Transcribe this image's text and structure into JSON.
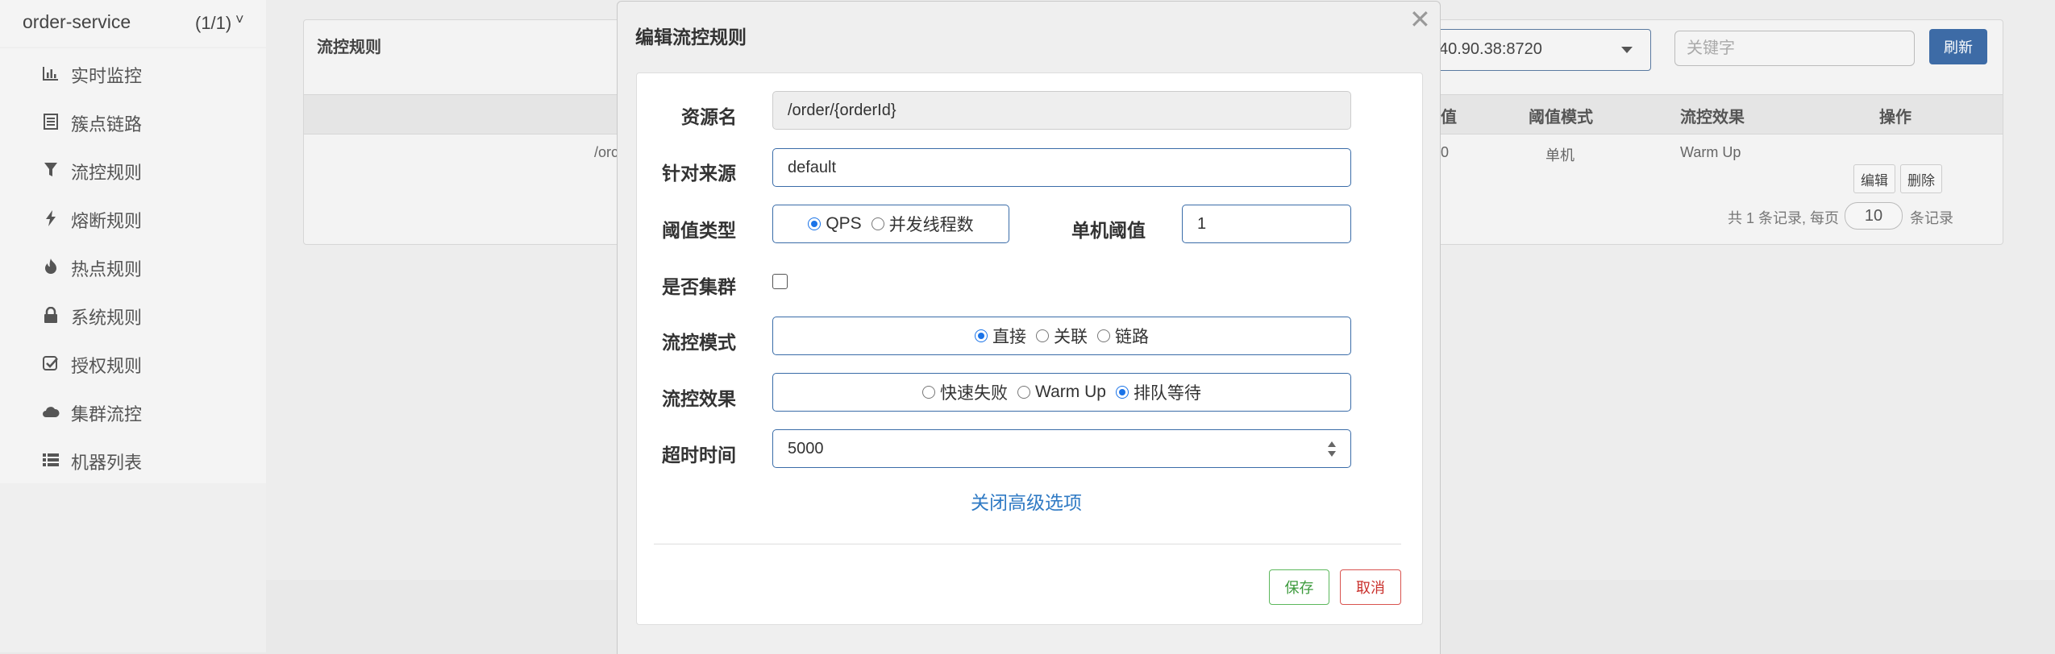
{
  "sidebar": {
    "app_name": "order-service",
    "app_count": "(1/1)",
    "items": [
      {
        "label": "实时监控",
        "icon": "bar-chart-icon"
      },
      {
        "label": "簇点链路",
        "icon": "list-icon"
      },
      {
        "label": "流控规则",
        "icon": "filter-icon"
      },
      {
        "label": "熔断规则",
        "icon": "bolt-icon"
      },
      {
        "label": "热点规则",
        "icon": "fire-icon"
      },
      {
        "label": "系统规则",
        "icon": "lock-icon"
      },
      {
        "label": "授权规则",
        "icon": "check-square-icon"
      },
      {
        "label": "集群流控",
        "icon": "cloud-icon"
      },
      {
        "label": "机器列表",
        "icon": "th-list-icon"
      }
    ]
  },
  "panel": {
    "title": "流控规则",
    "machine_select": "40.90.38:8720",
    "keyword_placeholder": "关键字",
    "refresh_label": "刷新",
    "headers": {
      "threshold": "值",
      "threshold_mode": "阈值模式",
      "flow_effect": "流控效果",
      "actions": "操作"
    },
    "row": {
      "resource": "/orc",
      "threshold": "0",
      "threshold_mode": "单机",
      "flow_effect": "Warm Up",
      "edit_label": "编辑",
      "delete_label": "删除"
    },
    "pager_prefix": "共 1 条记录, 每页",
    "page_size": "10",
    "pager_suffix": "条记录"
  },
  "modal": {
    "title": "编辑流控规则",
    "fields": {
      "resource_label": "资源名",
      "resource_value": "/order/{orderId}",
      "source_label": "针对来源",
      "source_value": "default",
      "threshold_type_label": "阈值类型",
      "threshold_type_options": [
        "QPS",
        "并发线程数"
      ],
      "threshold_type_selected": "QPS",
      "single_threshold_label": "单机阈值",
      "single_threshold_value": "1",
      "cluster_label": "是否集群",
      "cluster_checked": false,
      "flow_mode_label": "流控模式",
      "flow_mode_options": [
        "直接",
        "关联",
        "链路"
      ],
      "flow_mode_selected": "直接",
      "flow_effect_label": "流控效果",
      "flow_effect_options": [
        "快速失败",
        "Warm Up",
        "排队等待"
      ],
      "flow_effect_selected": "排队等待",
      "timeout_label": "超时时间",
      "timeout_value": "5000"
    },
    "advanced_toggle": "关闭高级选项",
    "save_label": "保存",
    "cancel_label": "取消"
  },
  "colors": {
    "primary": "#3d6ba6",
    "link": "#2f7ac4",
    "save": "#5cb85c",
    "cancel": "#d9534f",
    "radio_on": "#1a73e8"
  }
}
